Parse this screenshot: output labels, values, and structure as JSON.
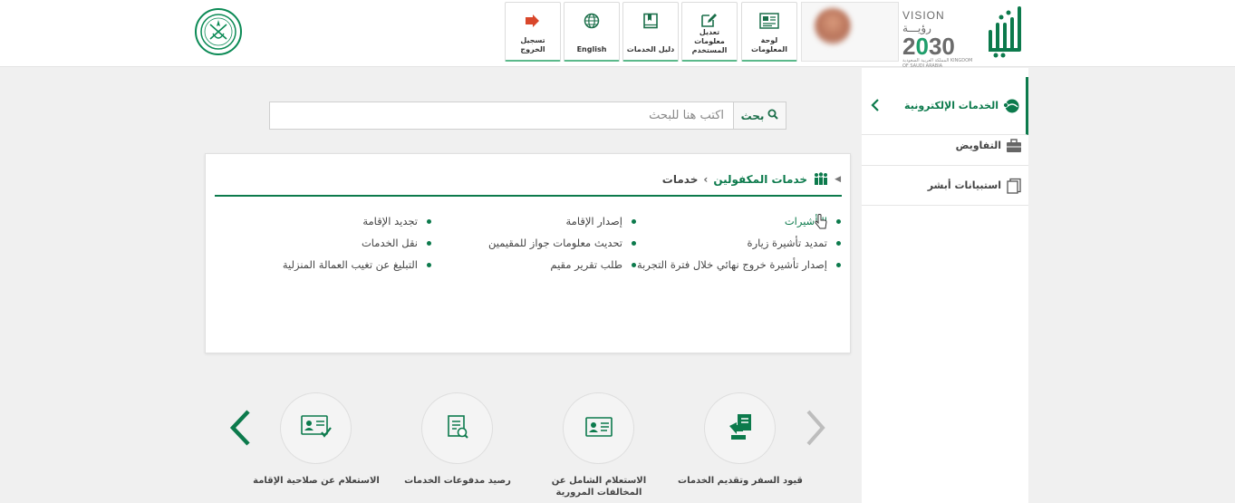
{
  "header": {
    "buttons": [
      {
        "id": "dashboard",
        "label": "لوحة المعلومات",
        "icon": "dashboard-icon"
      },
      {
        "id": "edit-user",
        "label": "تعديل معلومات المستخدم",
        "icon": "edit-icon"
      },
      {
        "id": "guide",
        "label": "دليل الخدمات",
        "icon": "book-icon"
      },
      {
        "id": "english",
        "label": "English",
        "icon": "globe-icon"
      },
      {
        "id": "logout",
        "label": "تسجيل الخروج",
        "icon": "logout-icon"
      }
    ],
    "vision": {
      "line1": "VISION رؤيـــة",
      "line2a": "2",
      "line2o": "0",
      "line2b": "30",
      "line3": "المملكة العربية السعودية KINGDOM OF SAUDI ARABIA"
    }
  },
  "sidebar": {
    "items": [
      {
        "label": "الخدمات الإلكترونية",
        "icon": "eservices-icon",
        "active": true
      },
      {
        "label": "التفاويض",
        "icon": "briefcase-icon"
      },
      {
        "label": "استبيانات أبشر",
        "icon": "survey-icon"
      }
    ]
  },
  "search": {
    "button_label": "بحث",
    "placeholder": "اكتب هنا للبحث"
  },
  "breadcrumb": {
    "section": "خدمات المكفولين",
    "current": "خدمات"
  },
  "services": {
    "col1": [
      "التأشيرات",
      "تمديد تأشيرة زيارة",
      "إصدار تأشيرة خروج نهائي خلال فترة التجربة"
    ],
    "col2": [
      "إصدار الإقامة",
      "تحديث معلومات جواز للمقيمين",
      "طلب تقرير مقيم"
    ],
    "col3": [
      "تجديد الإقامة",
      "نقل الخدمات",
      "التبليغ عن تغيب العمالة المنزلية"
    ]
  },
  "carousel": [
    {
      "label": "قيود السفر وتقديم الخدمات",
      "icon": "travel-restrictions-icon"
    },
    {
      "label": "الاستعلام الشامل عن المخالفات المرورية",
      "icon": "violations-card-icon"
    },
    {
      "label": "رصيد مدفوعات الخدمات",
      "icon": "payments-icon"
    },
    {
      "label": "الاستعلام عن صلاحية الإقامة",
      "icon": "residency-validity-icon"
    }
  ],
  "colors": {
    "brand": "#0c7a4c",
    "logout": "#d9472b"
  }
}
